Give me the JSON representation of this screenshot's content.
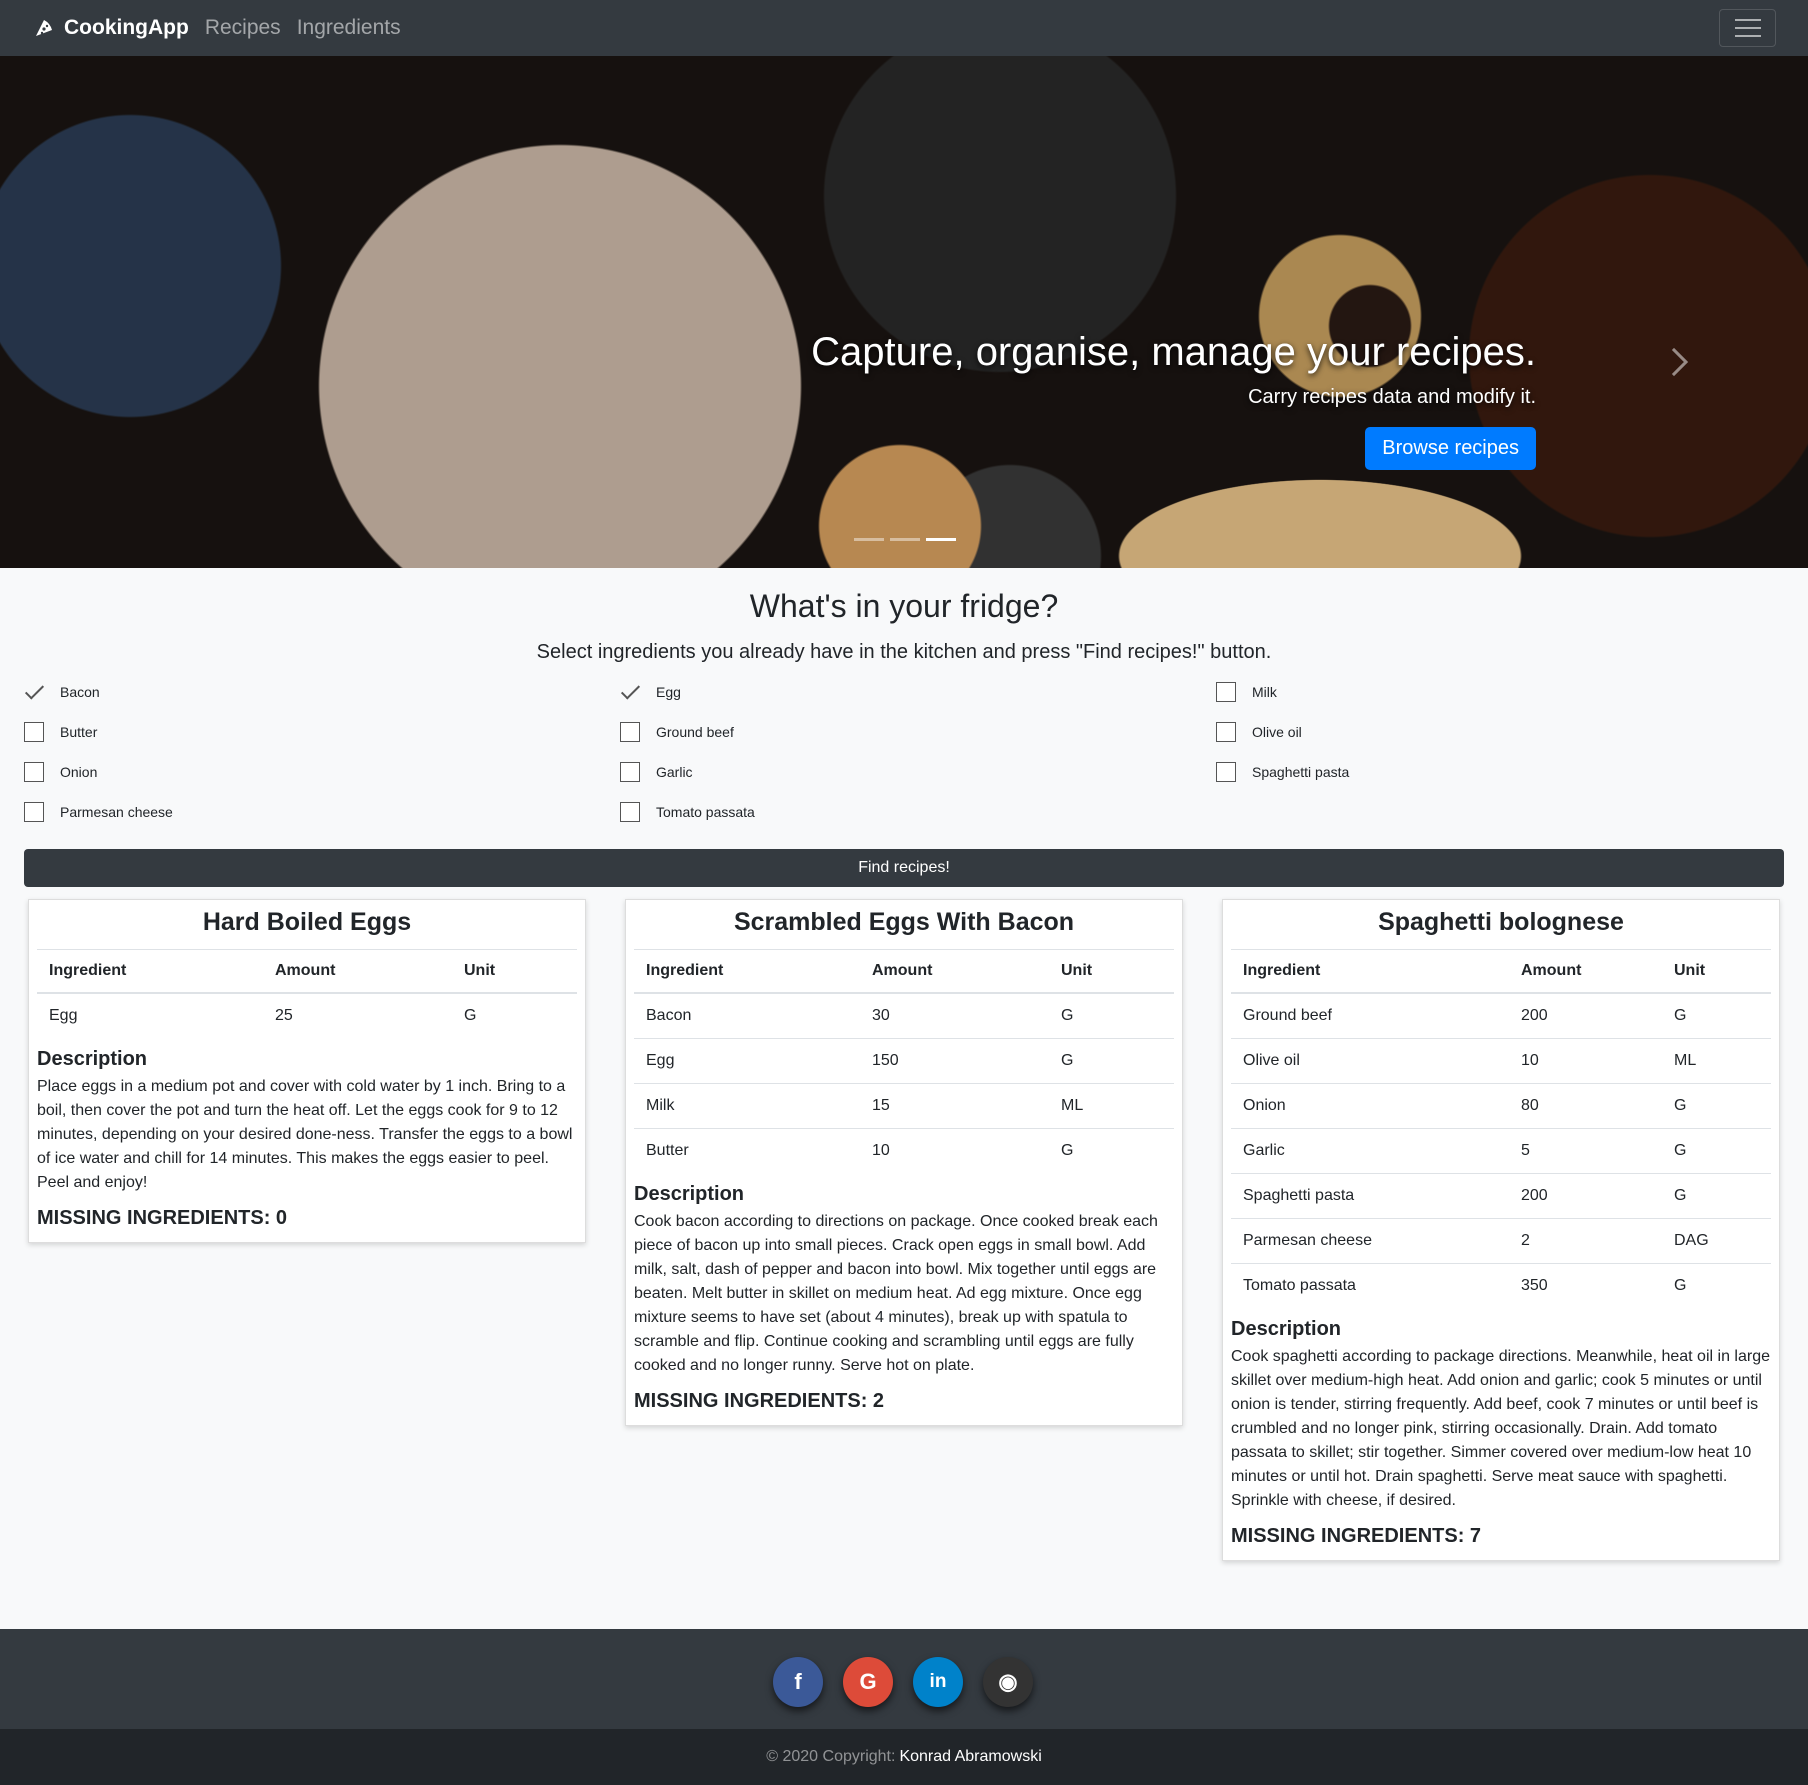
{
  "nav": {
    "brand": "CookingApp",
    "links": [
      "Recipes",
      "Ingredients"
    ],
    "brand_icon": "pizza-icon",
    "toggler_icon": "hamburger-icon"
  },
  "hero": {
    "title": "Capture, organise, manage your recipes.",
    "subtitle": "Carry recipes data and modify it.",
    "button": "Browse recipes",
    "indicator_count": 3,
    "active_indicator": 3
  },
  "fridge": {
    "heading": "What's in your fridge?",
    "instructions": "Select ingredients you already have in the kitchen and press \"Find recipes!\" button.",
    "ingredients": [
      {
        "name": "Bacon",
        "checked": true
      },
      {
        "name": "Butter",
        "checked": false
      },
      {
        "name": "Onion",
        "checked": false
      },
      {
        "name": "Parmesan cheese",
        "checked": false
      },
      {
        "name": "Egg",
        "checked": true
      },
      {
        "name": "Ground beef",
        "checked": false
      },
      {
        "name": "Garlic",
        "checked": false
      },
      {
        "name": "Tomato passata",
        "checked": false
      },
      {
        "name": "Milk",
        "checked": false
      },
      {
        "name": "Olive oil",
        "checked": false
      },
      {
        "name": "Spaghetti pasta",
        "checked": false
      }
    ],
    "find_button": "Find recipes!"
  },
  "recipes": [
    {
      "title": "Hard Boiled Eggs",
      "headers": [
        "Ingredient",
        "Amount",
        "Unit"
      ],
      "rows": [
        [
          "Egg",
          "25",
          "G"
        ]
      ],
      "description_heading": "Description",
      "description": "Place eggs in a medium pot and cover with cold water by 1 inch. Bring to a boil, then cover the pot and turn the heat off. Let the eggs cook for 9 to 12 minutes, depending on your desired done-ness. Transfer the eggs to a bowl of ice water and chill for 14 minutes. This makes the eggs easier to peel. Peel and enjoy!",
      "missing": "MISSING INGREDIENTS: 0"
    },
    {
      "title": "Scrambled Eggs With Bacon",
      "headers": [
        "Ingredient",
        "Amount",
        "Unit"
      ],
      "rows": [
        [
          "Bacon",
          "30",
          "G"
        ],
        [
          "Egg",
          "150",
          "G"
        ],
        [
          "Milk",
          "15",
          "ML"
        ],
        [
          "Butter",
          "10",
          "G"
        ]
      ],
      "description_heading": "Description",
      "description": "Cook bacon according to directions on package. Once cooked break each piece of bacon up into small pieces. Crack open eggs in small bowl. Add milk, salt, dash of pepper and bacon into bowl. Mix together until eggs are beaten. Melt butter in skillet on medium heat. Ad egg mixture. Once egg mixture seems to have set (about 4 minutes), break up with spatula to scramble and flip. Continue cooking and scrambling until eggs are fully cooked and no longer runny. Serve hot on plate.",
      "missing": "MISSING INGREDIENTS: 2"
    },
    {
      "title": "Spaghetti bolognese",
      "headers": [
        "Ingredient",
        "Amount",
        "Unit"
      ],
      "rows": [
        [
          "Ground beef",
          "200",
          "G"
        ],
        [
          "Olive oil",
          "10",
          "ML"
        ],
        [
          "Onion",
          "80",
          "G"
        ],
        [
          "Garlic",
          "5",
          "G"
        ],
        [
          "Spaghetti pasta",
          "200",
          "G"
        ],
        [
          "Parmesan cheese",
          "2",
          "DAG"
        ],
        [
          "Tomato passata",
          "350",
          "G"
        ]
      ],
      "description_heading": "Description",
      "description": "Cook spaghetti according to package directions. Meanwhile, heat oil in large skillet over medium-high heat. Add onion and garlic; cook 5 minutes or until onion is tender, stirring frequently. Add beef, cook 7 minutes or until beef is crumbled and no longer pink, stirring occasionally. Drain. Add tomato passata to skillet; stir together. Simmer covered over medium-low heat 10 minutes or until hot. Drain spaghetti. Serve meat sauce with spaghetti. Sprinkle with cheese, if desired.",
      "missing": "MISSING INGREDIENTS: 7"
    }
  ],
  "footer": {
    "socials": [
      {
        "icon": "facebook-icon",
        "glyph": "f",
        "color": "#3b5998"
      },
      {
        "icon": "google-icon",
        "glyph": "G",
        "color": "#dd4b39"
      },
      {
        "icon": "linkedin-icon",
        "glyph": "in",
        "color": "#0082ca"
      },
      {
        "icon": "github-icon",
        "glyph": "◉",
        "color": "#333333"
      }
    ],
    "copyright": "© 2020 Copyright:",
    "author": "Konrad Abramowski"
  },
  "colors": {
    "primary": "#007bff",
    "dark": "#343a40",
    "darker": "#212529"
  }
}
